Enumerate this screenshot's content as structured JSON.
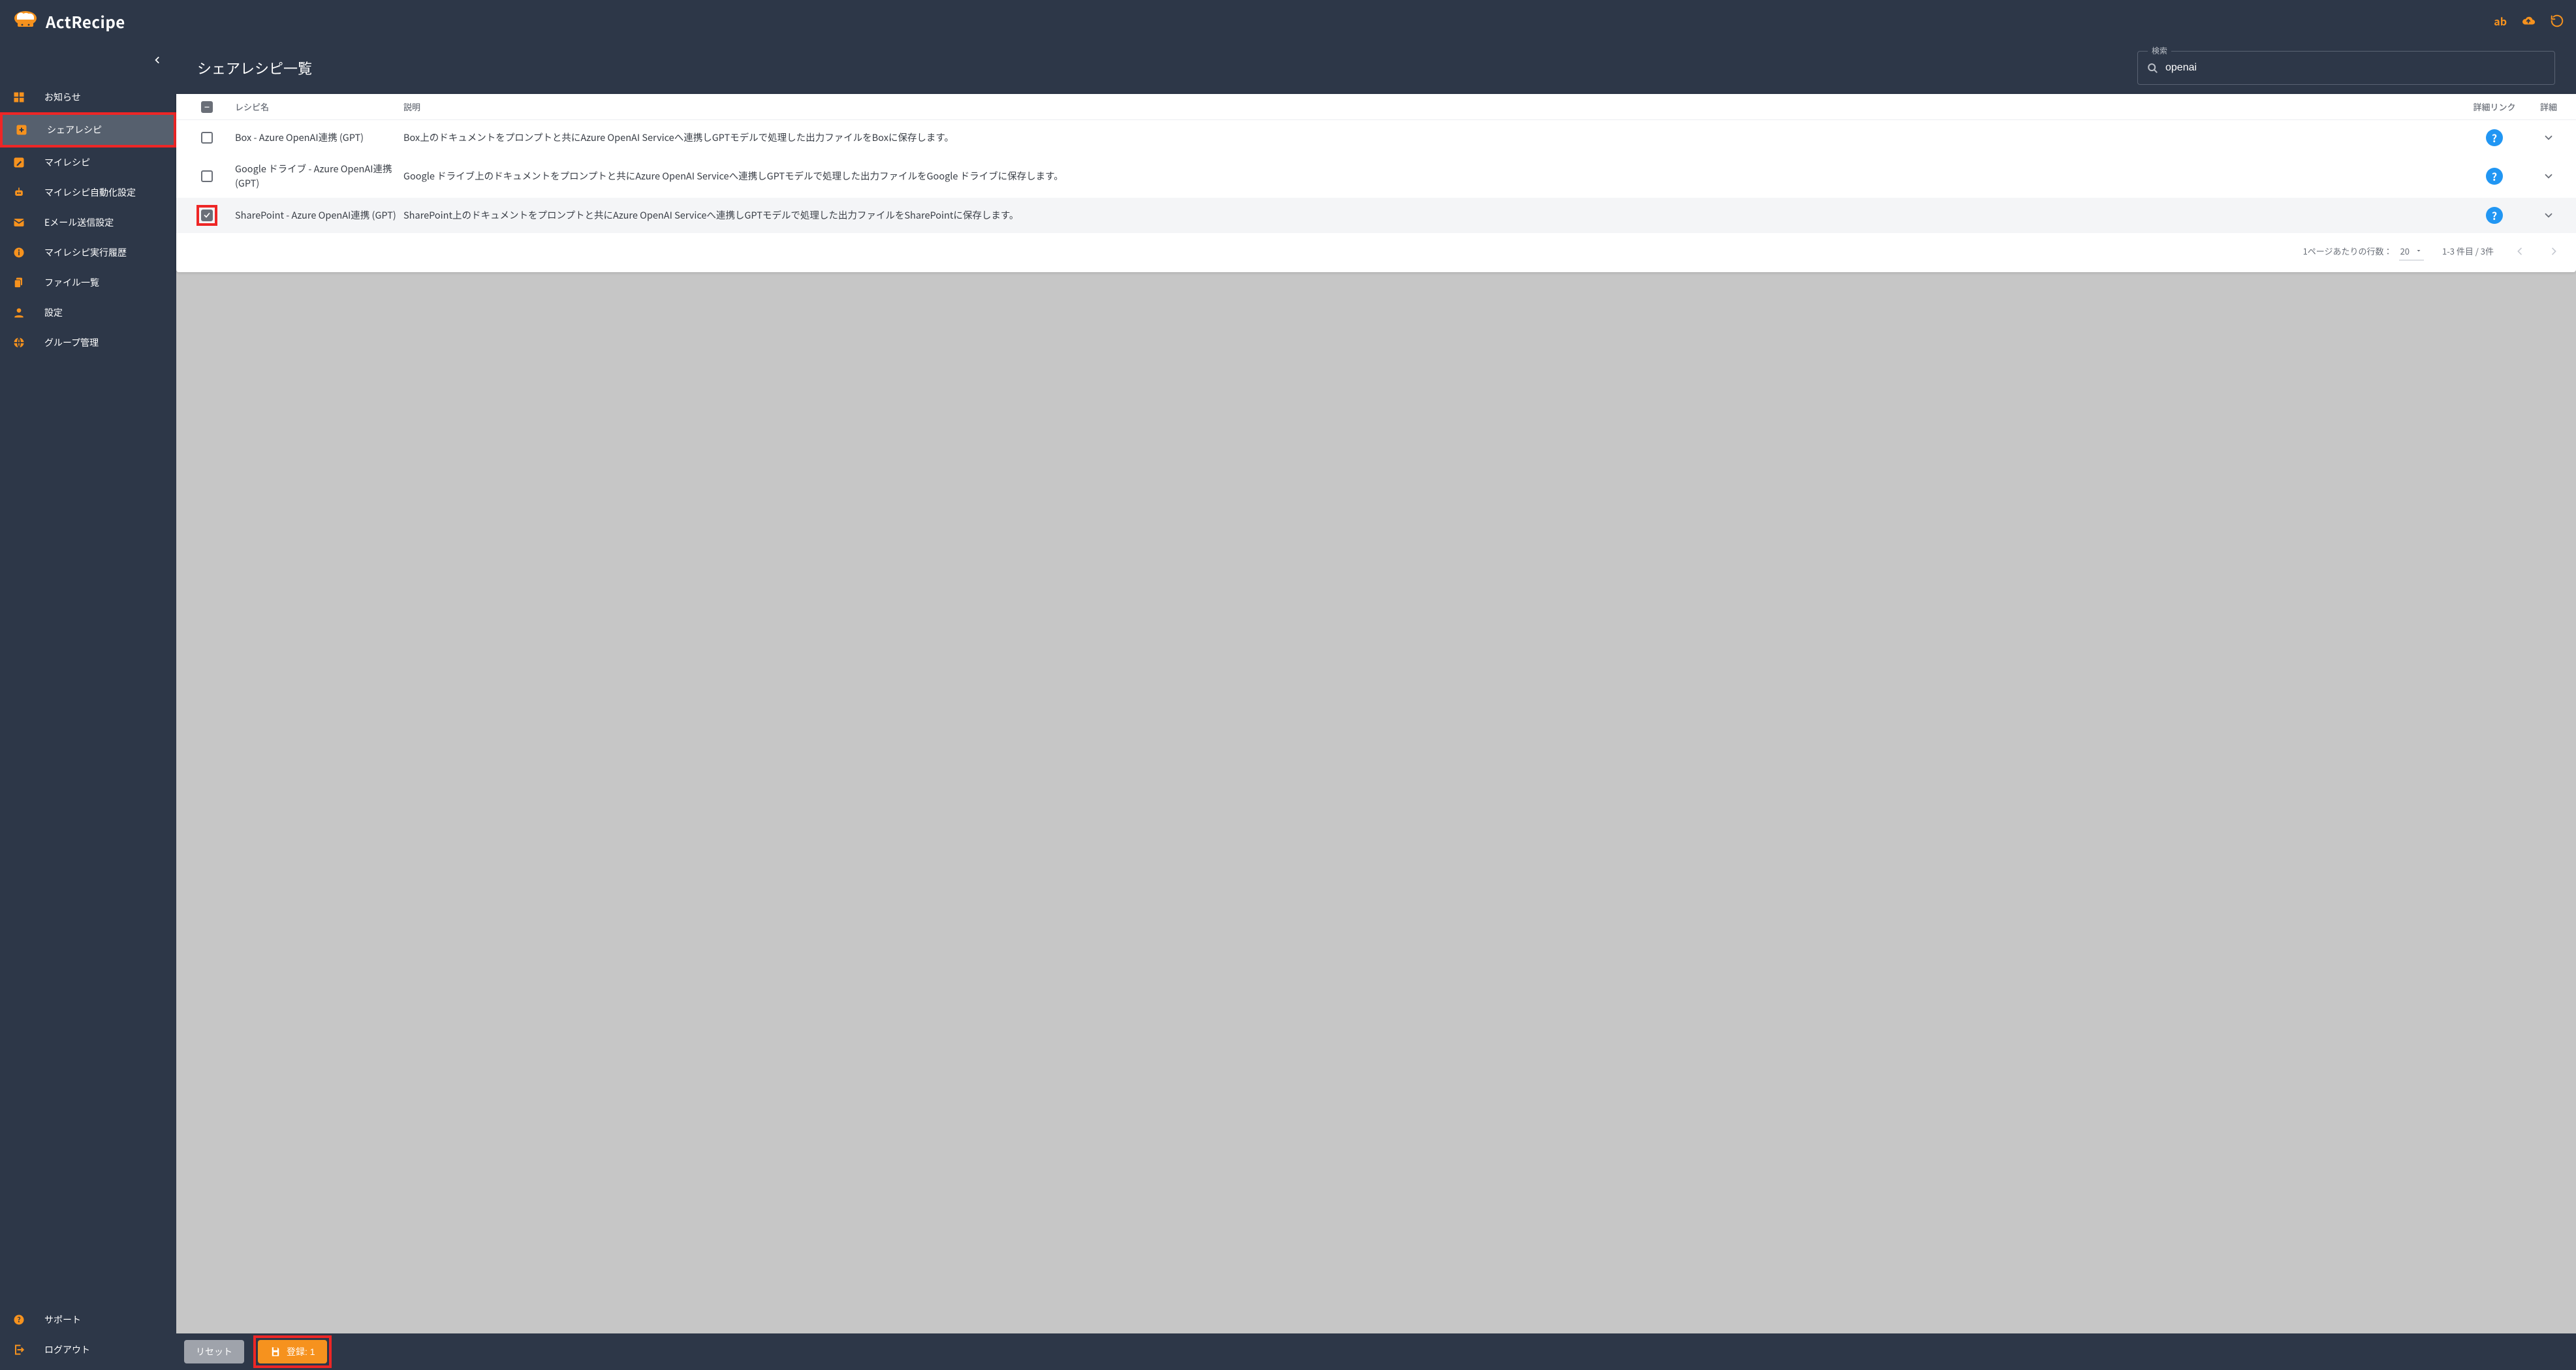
{
  "header": {
    "app_name": "ActRecipe",
    "user_label": "ab"
  },
  "sidebar": {
    "items": [
      {
        "id": "news",
        "label": "お知らせ"
      },
      {
        "id": "share",
        "label": "シェアレシピ"
      },
      {
        "id": "mine",
        "label": "マイレシピ"
      },
      {
        "id": "auto",
        "label": "マイレシピ自動化設定"
      },
      {
        "id": "email",
        "label": "Eメール送信設定"
      },
      {
        "id": "history",
        "label": "マイレシピ実行履歴"
      },
      {
        "id": "files",
        "label": "ファイル一覧"
      },
      {
        "id": "settings",
        "label": "設定"
      },
      {
        "id": "groups",
        "label": "グループ管理"
      }
    ],
    "footer": [
      {
        "id": "support",
        "label": "サポート"
      },
      {
        "id": "logout",
        "label": "ログアウト"
      }
    ]
  },
  "page": {
    "title": "シェアレシピ一覧",
    "search_label": "検索",
    "search_value": "openai"
  },
  "table": {
    "headers": {
      "name": "レシピ名",
      "desc": "説明",
      "link": "詳細リンク",
      "detail": "詳細"
    },
    "rows": [
      {
        "checked": false,
        "name": "Box - Azure OpenAI連携 (GPT)",
        "desc": "Box上のドキュメントをプロンプトと共にAzure OpenAI Serviceへ連携しGPTモデルで処理した出力ファイルをBoxに保存します。"
      },
      {
        "checked": false,
        "name": "Google ドライブ - Azure OpenAI連携 (GPT)",
        "desc": "Google ドライブ上のドキュメントをプロンプトと共にAzure OpenAI Serviceへ連携しGPTモデルで処理した出力ファイルをGoogle ドライブに保存します。"
      },
      {
        "checked": true,
        "name": "SharePoint - Azure OpenAI連携 (GPT)",
        "desc": "SharePoint上のドキュメントをプロンプトと共にAzure OpenAI Serviceへ連携しGPTモデルで処理した出力ファイルをSharePointに保存します。"
      }
    ]
  },
  "pagination": {
    "rows_label": "1ページあたりの行数：",
    "page_size": "20",
    "range": "1-3 件目 / 3件"
  },
  "footer": {
    "reset": "リセット",
    "register": "登録: 1"
  }
}
